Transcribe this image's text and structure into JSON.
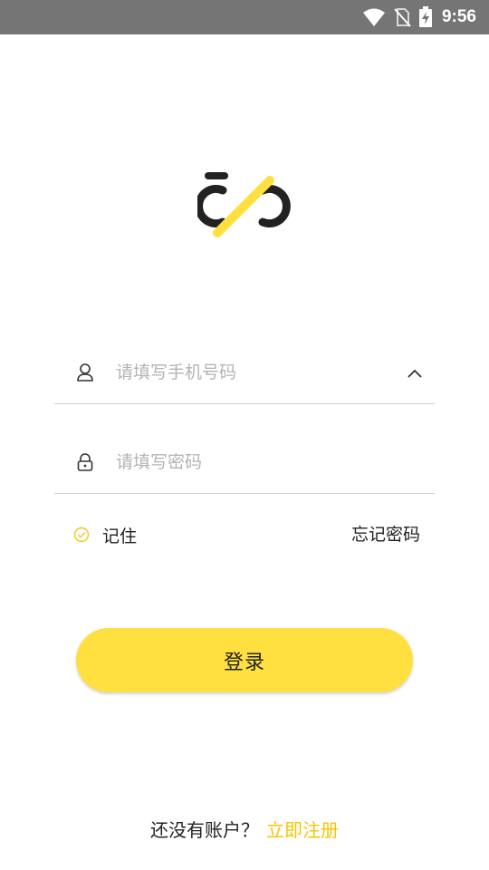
{
  "status_bar": {
    "time": "9:56"
  },
  "colors": {
    "accent": "#ffe040",
    "link": "#f6c500",
    "logo_dark": "#222222"
  },
  "login_form": {
    "phone_placeholder": "请填写手机号码",
    "password_placeholder": "请填写密码",
    "remember_label": "记住",
    "forgot_password": "忘记密码",
    "login_button": "登录"
  },
  "register": {
    "prompt": "还没有账户？",
    "link": "立即注册"
  },
  "icons": [
    "wifi-icon",
    "no-sim-icon",
    "battery-charging-icon",
    "user-icon",
    "lock-icon",
    "chevron-up-icon",
    "check-circle-icon",
    "app-logo"
  ]
}
